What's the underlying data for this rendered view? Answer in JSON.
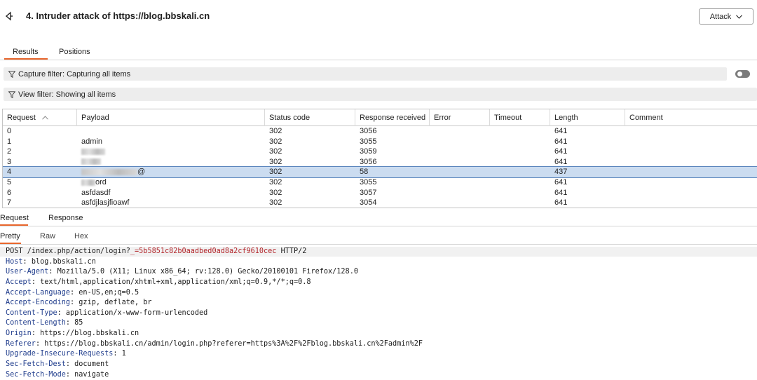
{
  "window": {
    "title": "4. Intruder attack of https://blog.bbskali.cn",
    "attack_menu_label": "Attack"
  },
  "tabs": {
    "results": "Results",
    "positions": "Positions"
  },
  "filters": {
    "capture": "Capture filter: Capturing all items",
    "view": "View filter: Showing all items"
  },
  "table": {
    "columns": [
      "Request",
      "Payload",
      "Status code",
      "Response received",
      "Error",
      "Timeout",
      "Length",
      "Comment"
    ],
    "rows": [
      {
        "request": "0",
        "payload": "",
        "status": "302",
        "received": "3056",
        "error": "",
        "timeout": "",
        "length": "641",
        "comment": ""
      },
      {
        "request": "1",
        "payload": "admin",
        "status": "302",
        "received": "3055",
        "error": "",
        "timeout": "",
        "length": "641",
        "comment": ""
      },
      {
        "request": "2",
        "payload": "",
        "status": "302",
        "received": "3059",
        "error": "",
        "timeout": "",
        "length": "641",
        "comment": ""
      },
      {
        "request": "3",
        "payload": "",
        "status": "302",
        "received": "3056",
        "error": "",
        "timeout": "",
        "length": "641",
        "comment": ""
      },
      {
        "request": "4",
        "payload": "@",
        "status": "302",
        "received": "58",
        "error": "",
        "timeout": "",
        "length": "437",
        "comment": ""
      },
      {
        "request": "5",
        "payload": "ord",
        "status": "302",
        "received": "3055",
        "error": "",
        "timeout": "",
        "length": "641",
        "comment": ""
      },
      {
        "request": "6",
        "payload": "asfdasdf",
        "status": "302",
        "received": "3057",
        "error": "",
        "timeout": "",
        "length": "641",
        "comment": ""
      },
      {
        "request": "7",
        "payload": "asfdjlasjfioawf",
        "status": "302",
        "received": "3054",
        "error": "",
        "timeout": "",
        "length": "641",
        "comment": ""
      }
    ],
    "selected_row": "4"
  },
  "message_tabs": {
    "request": "Request",
    "response": "Response"
  },
  "view_tabs": {
    "pretty": "Pretty",
    "raw": "Raw",
    "hex": "Hex"
  },
  "request": {
    "method": "POST",
    "path": "/index.php/action/login?",
    "param_name": "_=",
    "param_value": "5b5851c82b0aadbed0ad8a2cf9610cec",
    "protocol": "HTTP/2",
    "headers": [
      {
        "name": "Host",
        "value": "blog.bbskali.cn"
      },
      {
        "name": "User-Agent",
        "value": "Mozilla/5.0 (X11; Linux x86_64; rv:128.0) Gecko/20100101 Firefox/128.0"
      },
      {
        "name": "Accept",
        "value": "text/html,application/xhtml+xml,application/xml;q=0.9,*/*;q=0.8"
      },
      {
        "name": "Accept-Language",
        "value": "en-US,en;q=0.5"
      },
      {
        "name": "Accept-Encoding",
        "value": "gzip, deflate, br"
      },
      {
        "name": "Content-Type",
        "value": "application/x-www-form-urlencoded"
      },
      {
        "name": "Content-Length",
        "value": "85"
      },
      {
        "name": "Origin",
        "value": "https://blog.bbskali.cn"
      },
      {
        "name": "Referer",
        "value": "https://blog.bbskali.cn/admin/login.php?referer=https%3A%2F%2Fblog.bbskali.cn%2Fadmin%2F"
      },
      {
        "name": "Upgrade-Insecure-Requests",
        "value": "1"
      },
      {
        "name": "Sec-Fetch-Dest",
        "value": "document"
      },
      {
        "name": "Sec-Fetch-Mode",
        "value": "navigate"
      }
    ]
  },
  "colors": {
    "accent": "#e8662c",
    "selected_row": "#cbdcf0",
    "header_name": "#1f3c8c",
    "param": "#b3262b"
  }
}
